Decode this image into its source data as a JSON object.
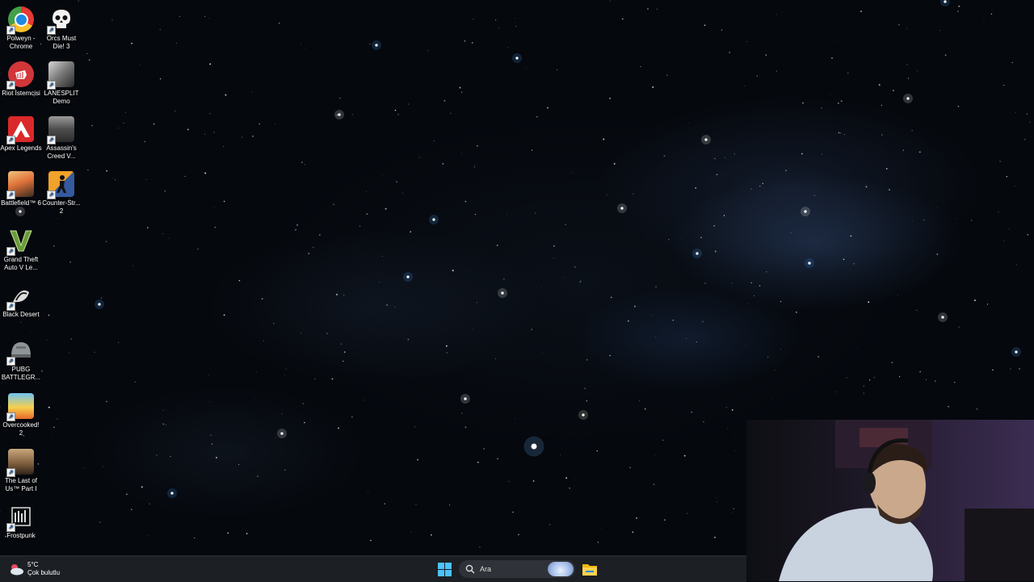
{
  "desktop_icons": [
    {
      "key": "chrome",
      "label": "Polweyn - Chrome",
      "icon": "chrome-icon"
    },
    {
      "key": "orcs",
      "label": "Orcs Must Die! 3",
      "icon": "skull-icon"
    },
    {
      "key": "riot",
      "label": "Riot İstemcisi",
      "icon": "riot-fist-icon"
    },
    {
      "key": "lanesplit",
      "label": "LANESPLIT Demo",
      "icon": "lanesplit-icon"
    },
    {
      "key": "apex",
      "label": "Apex Legends",
      "icon": "apex-icon"
    },
    {
      "key": "assassin",
      "label": "Assassin's Creed V...",
      "icon": "assassins-creed-icon"
    },
    {
      "key": "battlefield",
      "label": "Battlefield™ 6",
      "icon": "battlefield-icon"
    },
    {
      "key": "cs2",
      "label": "Counter-Str... 2",
      "icon": "counter-strike-icon"
    },
    {
      "key": "gta",
      "label": "Grand Theft Auto V Le...",
      "icon": "gta-v-icon"
    },
    {
      "key": "blackdesert",
      "label": "Black Desert",
      "icon": "black-desert-icon"
    },
    {
      "key": "pubg",
      "label": "PUBG BATTLEGR...",
      "icon": "pubg-helmet-icon"
    },
    {
      "key": "overcooked",
      "label": "Overcooked! 2",
      "icon": "overcooked-icon"
    },
    {
      "key": "lastofus",
      "label": "The Last of Us™ Part I",
      "icon": "last-of-us-icon"
    },
    {
      "key": "frostpunk",
      "label": "Frostpunk",
      "icon": "frostpunk-icon"
    }
  ],
  "taskbar": {
    "weather": {
      "temp": "5°C",
      "condition": "Çok bulutlu",
      "icon": "cloudy-weather-icon"
    },
    "search_placeholder": "Ara",
    "start_icon": "windows-start-icon",
    "search_icon": "search-icon",
    "explorer_icon": "file-explorer-icon"
  },
  "webcam": {
    "description_icon": "webcam-overlay"
  }
}
